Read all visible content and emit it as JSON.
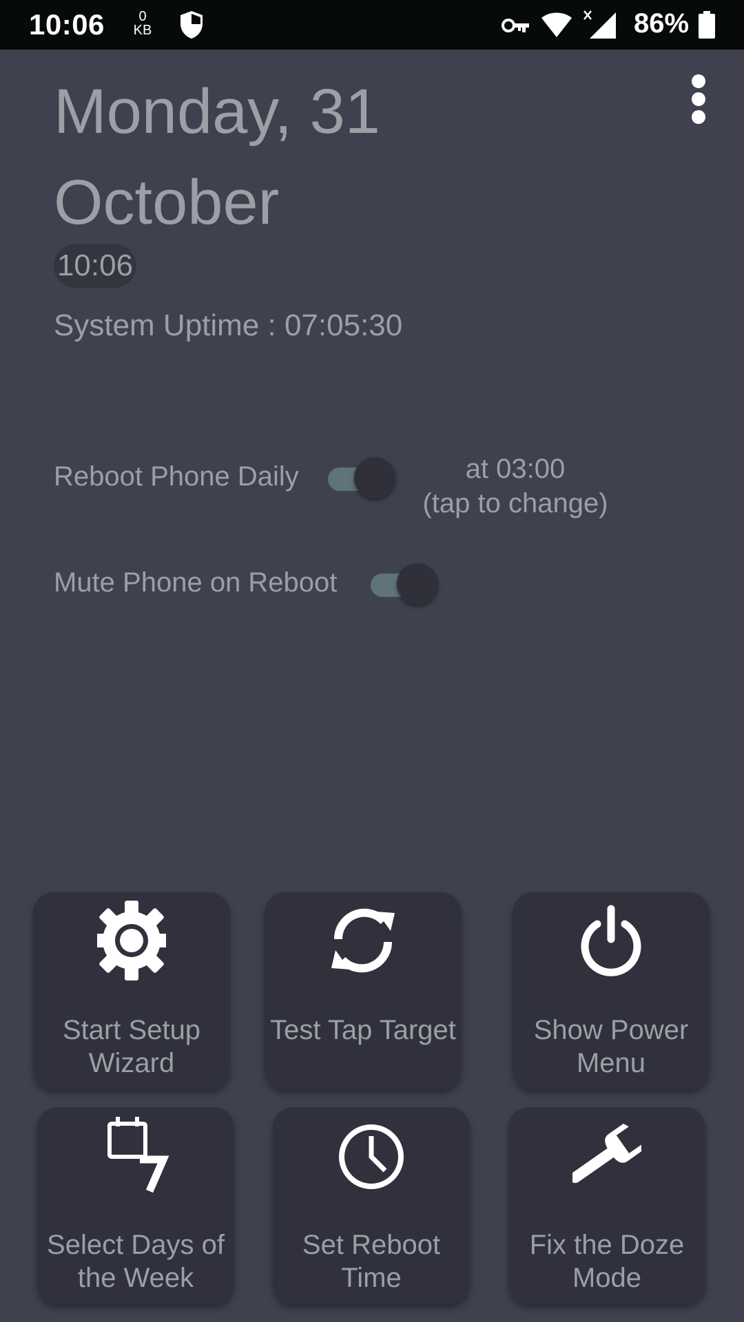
{
  "status_bar": {
    "time": "10:06",
    "data_speed": "0",
    "data_unit": "KB",
    "battery_percent": "86%",
    "icons": [
      "shield-icon",
      "vpn-key-icon",
      "wifi-icon",
      "signal-icon",
      "battery-icon"
    ]
  },
  "header": {
    "date_line1": "Monday, 31",
    "date_line2": "October",
    "time": "10:06",
    "uptime": "System Uptime : 07:05:30",
    "menu_icon": "more-vert-icon"
  },
  "settings": {
    "reboot_daily": {
      "label": "Reboot Phone Daily",
      "enabled": true
    },
    "reboot_time": {
      "line1": "at 03:00",
      "line2": "(tap to change)"
    },
    "mute_on_reboot": {
      "label": "Mute Phone on Reboot",
      "enabled": true
    }
  },
  "actions": [
    {
      "label": "Start Setup Wizard",
      "icon": "gear-icon"
    },
    {
      "label": "Test Tap Target",
      "icon": "refresh-icon"
    },
    {
      "label": "Show Power Menu",
      "icon": "power-icon"
    },
    {
      "label": "Select Days of the Week",
      "icon": "calendar-7-icon"
    },
    {
      "label": "Set Reboot Time",
      "icon": "clock-icon"
    },
    {
      "label": "Fix the Doze Mode",
      "icon": "wrench-icon"
    }
  ],
  "colors": {
    "background": "#3f414e",
    "tile": "#30313d",
    "text": "#9d9fa6",
    "toggle_track": "#5f7379",
    "status_bar": "#070b07"
  }
}
